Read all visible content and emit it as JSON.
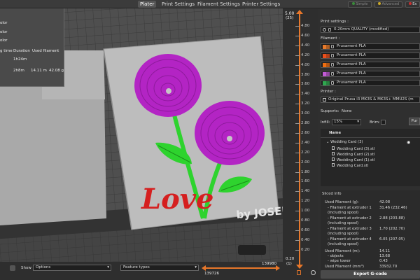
{
  "tabs": [
    {
      "label": "Plater",
      "active": true
    },
    {
      "label": "Print Settings"
    },
    {
      "label": "Filament Settings"
    },
    {
      "label": "Printer Settings"
    }
  ],
  "mode_buttons": {
    "simple": "Simple",
    "advanced": "Advanced",
    "expert": "Ex"
  },
  "legend": {
    "partial_rows": [
      "olor",
      "olor",
      "olor"
    ],
    "headers": {
      "time": "g time",
      "duration": "Duration",
      "used_filament": "Used filament"
    },
    "total_duration": "1h24m",
    "row": {
      "time": "2h8m",
      "length": "14.11 m",
      "weight": "42.08 g"
    }
  },
  "model_text": {
    "love": "Love",
    "watermark": "by JOSEPH"
  },
  "vertical_slider": {
    "top_value": "5.00",
    "top_layer": "(25)",
    "ticks": [
      "4.80",
      "4.60",
      "4.40",
      "4.20",
      "4.00",
      "3.80",
      "3.60",
      "3.40",
      "3.20",
      "3.00",
      "2.80",
      "2.60",
      "2.40",
      "2.20",
      "2.00",
      "1.80",
      "1.60",
      "1.40",
      "1.20",
      "1.00",
      "0.80",
      "0.60",
      "0.40",
      "0.20"
    ],
    "bottom_value": "0.20",
    "bottom_layer": "(1)"
  },
  "bottom_bar": {
    "show_label": "Show",
    "options_select": "Options",
    "feature_select": "Feature types",
    "h_top_value": "139980",
    "h_bottom_value": "139726"
  },
  "sidebar": {
    "print_settings_label": "Print settings :",
    "print_profile": "0.20mm QUALITY (modified)",
    "filament_label": "Filament :",
    "filaments": [
      {
        "name": "Prusament PLA",
        "color": "#e87a2a"
      },
      {
        "name": "Prusament PLA",
        "color": "#e94e1b"
      },
      {
        "name": "Prusament PLA",
        "color": "#ef6e11"
      },
      {
        "name": "Prusament PLA",
        "color": "#c25bd6"
      },
      {
        "name": "Prusament PLA",
        "color": "#2fa84f"
      }
    ],
    "printer_label": "Printer :",
    "printer_profile": "Original Prusa i3 MK3S & MK3S+ MMU2S (m",
    "supports_label": "Supports:",
    "supports_value": "None",
    "infill_label": "Infill:",
    "infill_value": "15%",
    "brim_label": "Brim:",
    "purge_button": "Pur",
    "name_header": "Name",
    "objects": {
      "group": "Wedding Card (3)",
      "items": [
        "Wedding Card (3).stl",
        "Wedding Card (2).stl",
        "Wedding Card (1).stl",
        "Wedding Card.stl"
      ]
    },
    "sliced_info": {
      "title": "Sliced Info",
      "rows": [
        {
          "label": "Used Filament (g):",
          "value": "42.08"
        },
        {
          "label": "- Filament at extruder 1",
          "value": "31.46 (232.46)"
        },
        {
          "label": "(including spool)",
          "value": ""
        },
        {
          "label": "- Filament at extruder 2",
          "value": "2.88 (203.88)"
        },
        {
          "label": "(including spool)",
          "value": ""
        },
        {
          "label": "- Filament at extruder 3",
          "value": "1.70 (202.70)"
        },
        {
          "label": "(including spool)",
          "value": ""
        },
        {
          "label": "- Filament at extruder 4",
          "value": "6.05 (207.05)"
        },
        {
          "label": "(including spool)",
          "value": ""
        },
        {
          "label": "Used Filament (m):",
          "value": "14.11"
        },
        {
          "label": "- objects",
          "value": "13.68"
        },
        {
          "label": "- wipe tower",
          "value": "0.43"
        },
        {
          "label": "Used Filament (mm³)",
          "value": "33932.70"
        }
      ]
    },
    "export_button": "Export G-code"
  },
  "colors": {
    "purple": "#b324c4",
    "green": "#2ed32e",
    "red": "#d51f1f",
    "orange": "#e8772a",
    "plate": "#bdbdbd"
  }
}
